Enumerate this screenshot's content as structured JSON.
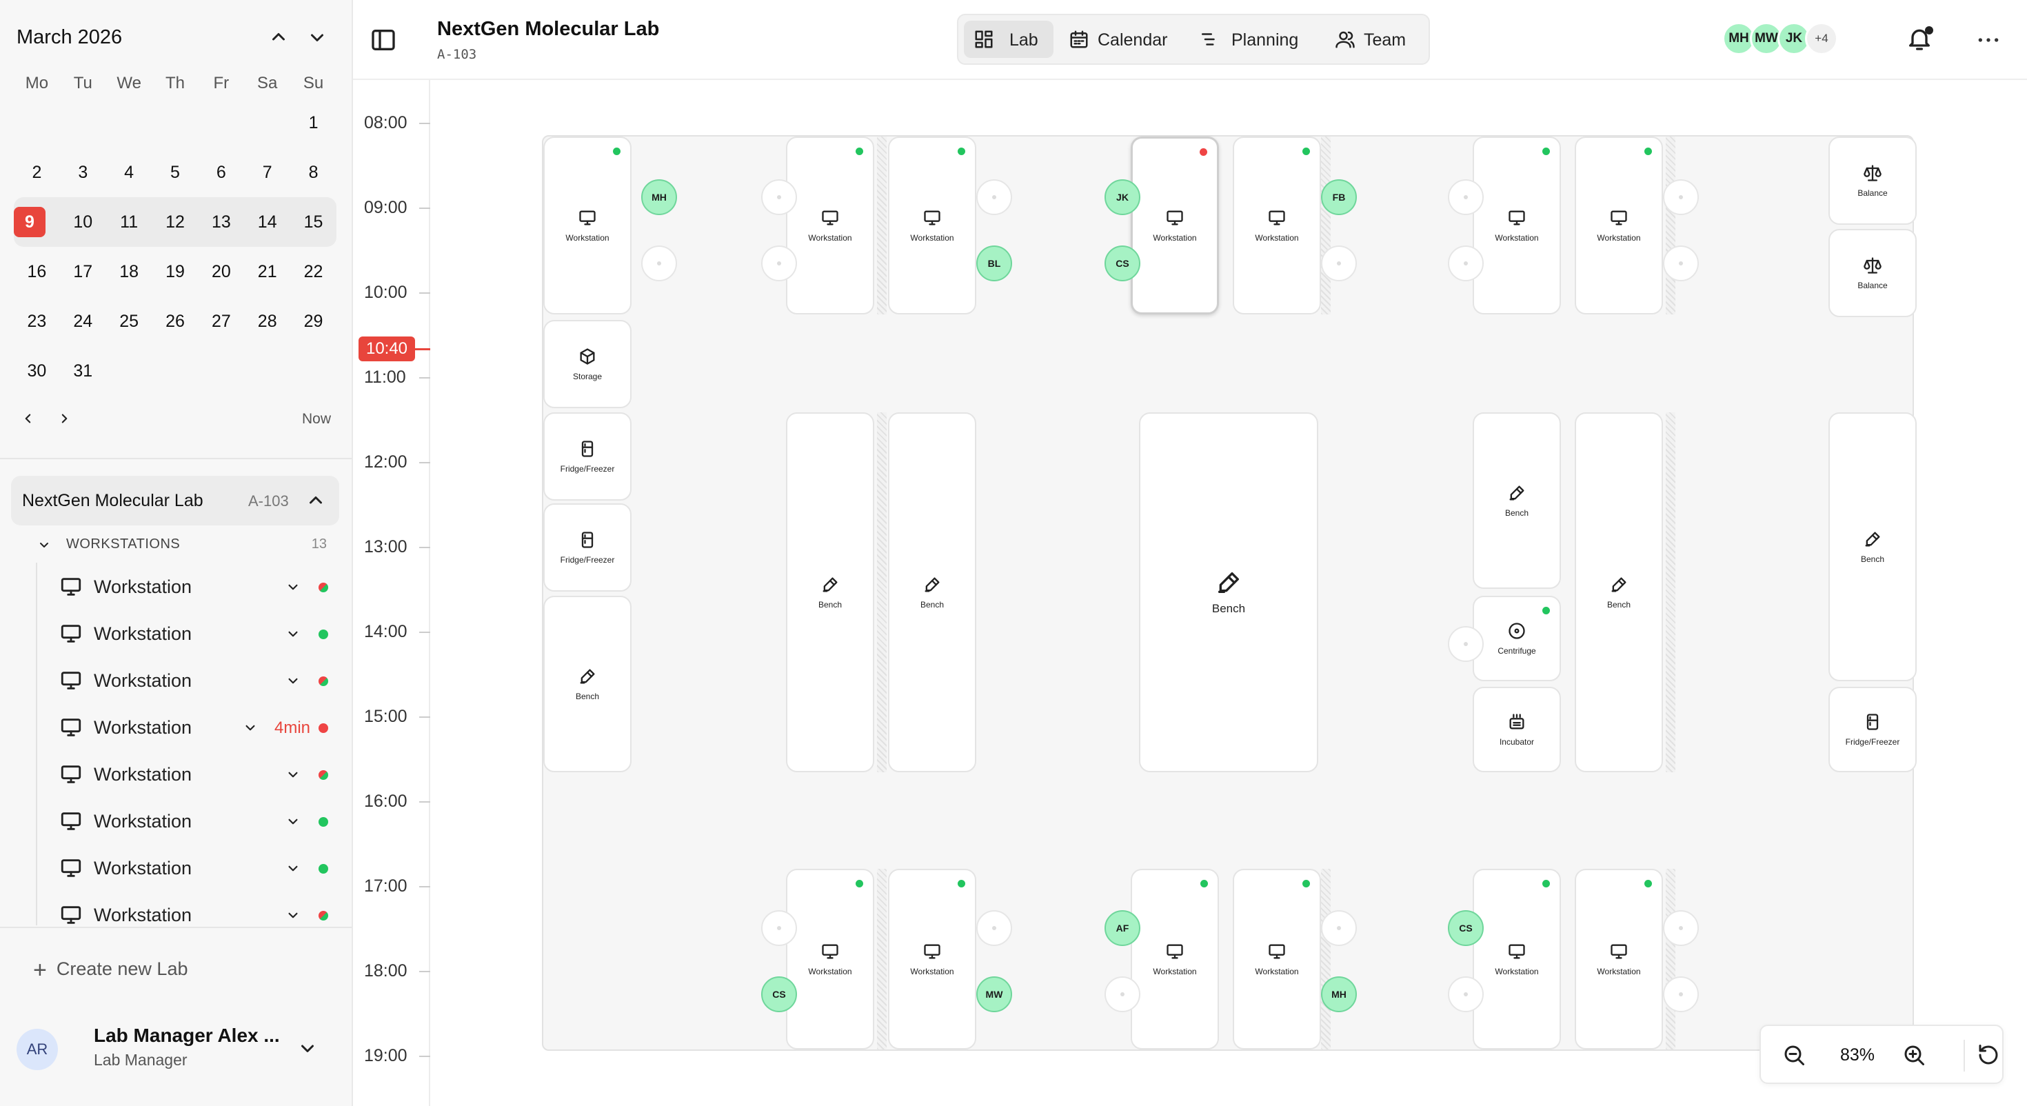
{
  "calendar": {
    "month": "March 2026",
    "weekdays": [
      "Mo",
      "Tu",
      "We",
      "Th",
      "Fr",
      "Sa",
      "Su"
    ],
    "weeks": [
      [
        "",
        "",
        "",
        "",
        "",
        "",
        "1"
      ],
      [
        "2",
        "3",
        "4",
        "5",
        "6",
        "7",
        "8"
      ],
      [
        "9",
        "10",
        "11",
        "12",
        "13",
        "14",
        "15"
      ],
      [
        "16",
        "17",
        "18",
        "19",
        "20",
        "21",
        "22"
      ],
      [
        "23",
        "24",
        "25",
        "26",
        "27",
        "28",
        "29"
      ],
      [
        "30",
        "31",
        "",
        "",
        "",
        "",
        ""
      ]
    ],
    "selected_day": "9",
    "now_label": "Now"
  },
  "sidebar": {
    "lab_name": "NextGen Molecular Lab",
    "lab_code": "A-103",
    "section_label": "WORKSTATIONS",
    "section_count": "13",
    "workstations": [
      {
        "label": "Workstation",
        "status": "mixed"
      },
      {
        "label": "Workstation",
        "status": "available"
      },
      {
        "label": "Workstation",
        "status": "mixed"
      },
      {
        "label": "Workstation",
        "status": "busy",
        "note": "4min"
      },
      {
        "label": "Workstation",
        "status": "mixed"
      },
      {
        "label": "Workstation",
        "status": "available"
      },
      {
        "label": "Workstation",
        "status": "available"
      },
      {
        "label": "Workstation",
        "status": "mixed"
      }
    ],
    "create_lab": "Create new Lab",
    "user": {
      "initials": "AR",
      "name": "Lab Manager Alex ...",
      "role": "Lab Manager"
    }
  },
  "timeline": {
    "hours": [
      "08:00",
      "09:00",
      "10:00",
      "11:00",
      "12:00",
      "13:00",
      "14:00",
      "15:00",
      "16:00",
      "17:00",
      "18:00",
      "19:00"
    ],
    "now": "10:40"
  },
  "header": {
    "title": "NextGen Molecular Lab",
    "subtitle": "A-103",
    "tabs": [
      {
        "label": "Lab",
        "icon": "grid-icon",
        "active": true
      },
      {
        "label": "Calendar",
        "icon": "calendar-icon"
      },
      {
        "label": "Planning",
        "icon": "planning-icon"
      },
      {
        "label": "Team",
        "icon": "team-icon"
      }
    ],
    "avatars": [
      "MH",
      "MW",
      "JK"
    ],
    "avatar_more": "+4"
  },
  "zoom": {
    "level": "83%"
  },
  "colors": {
    "available": "#22c55e",
    "busy": "#ef4444",
    "accent": "#e8453c",
    "seat": "#a6f2c4"
  },
  "lab": {
    "equipment": [
      {
        "type": "workstation",
        "label": "Workstation",
        "status": "available"
      },
      {
        "type": "workstation",
        "label": "Workstation",
        "status": "available"
      },
      {
        "type": "workstation",
        "label": "Workstation",
        "status": "available"
      },
      {
        "type": "workstation",
        "label": "Workstation",
        "status": "busy"
      },
      {
        "type": "workstation",
        "label": "Workstation",
        "status": "available"
      },
      {
        "type": "workstation",
        "label": "Workstation",
        "status": "available"
      },
      {
        "type": "workstation",
        "label": "Workstation",
        "status": "available"
      },
      {
        "type": "balance",
        "label": "Balance"
      },
      {
        "type": "balance",
        "label": "Balance"
      },
      {
        "type": "storage",
        "label": "Storage"
      },
      {
        "type": "fridge",
        "label": "Fridge/Freezer"
      },
      {
        "type": "fridge",
        "label": "Fridge/Freezer"
      },
      {
        "type": "bench",
        "label": "Bench"
      },
      {
        "type": "bench",
        "label": "Bench"
      },
      {
        "type": "bench",
        "label": "Bench"
      },
      {
        "type": "bench",
        "label": "Bench"
      },
      {
        "type": "bench",
        "label": "Bench"
      },
      {
        "type": "centrifuge",
        "label": "Centrifuge",
        "status": "available"
      },
      {
        "type": "incubator",
        "label": "Incubator"
      },
      {
        "type": "bench",
        "label": "Bench"
      },
      {
        "type": "bench",
        "label": "Bench"
      },
      {
        "type": "fridge",
        "label": "Fridge/Freezer"
      },
      {
        "type": "workstation",
        "label": "Workstation",
        "status": "available"
      },
      {
        "type": "workstation",
        "label": "Workstation",
        "status": "available"
      },
      {
        "type": "workstation",
        "label": "Workstation",
        "status": "available"
      },
      {
        "type": "workstation",
        "label": "Workstation",
        "status": "available"
      },
      {
        "type": "workstation",
        "label": "Workstation",
        "status": "available"
      },
      {
        "type": "workstation",
        "label": "Workstation",
        "status": "available"
      }
    ],
    "seats": [
      "MH",
      "",
      "",
      "",
      "",
      "BL",
      "JK",
      "CS",
      "FB",
      "",
      "",
      "",
      "",
      "",
      "",
      "",
      "",
      "",
      "AF",
      "",
      "",
      "MH",
      "CS",
      "",
      "",
      "",
      "",
      "",
      ""
    ],
    "seats_bottom_extra": [
      "",
      "CS",
      "",
      "MW"
    ]
  }
}
